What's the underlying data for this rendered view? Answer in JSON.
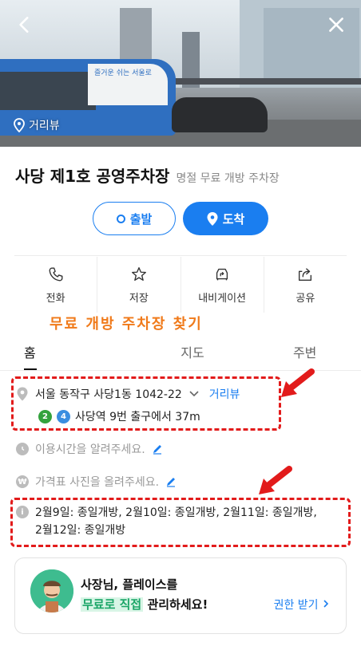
{
  "hero": {
    "street_view_label": "거리뷰",
    "bus_text": "즐거운 쉬는 서울로"
  },
  "place": {
    "name": "사당 제1호 공영주차장",
    "category": "명절 무료 개방 주차장"
  },
  "nav": {
    "start_label": "출발",
    "arrive_label": "도착"
  },
  "actions": [
    {
      "label": "전화",
      "icon": "phone-icon"
    },
    {
      "label": "저장",
      "icon": "star-icon"
    },
    {
      "label": "내비게이션",
      "icon": "car-icon"
    },
    {
      "label": "공유",
      "icon": "share-icon"
    }
  ],
  "banner": "무료 개방 주차장 찾기",
  "tabs": [
    {
      "label": "홈",
      "active": true
    },
    {
      "label": "지도",
      "active": false
    },
    {
      "label": "주변",
      "active": false
    }
  ],
  "address": {
    "text": "서울 동작구 사당1동 1042-22",
    "street_view_link": "거리뷰",
    "line1": "2",
    "line2": "4",
    "line1_color": "#33a23d",
    "line2_color": "#3a8ee0",
    "subway": "사당역 9번 출구에서 37m"
  },
  "hours_prompt": "이용시간을 알려주세요.",
  "price_prompt": "가격표 사진을 올려주세요.",
  "notice": {
    "line1": "2월9일: 종일개방, 2월10일: 종일개방, 2월11일: 종일개방,",
    "line2": "2월12일: 종일개방"
  },
  "owner_card": {
    "line1": "사장님, 플레이스를",
    "highlight": "무료로 직접",
    "line2_rest": " 관리하세요!",
    "cta": "권한 받기"
  },
  "colors": {
    "accent": "#1a7ef0",
    "annotation_red": "#e21b1b",
    "banner_orange": "#f07a1a"
  }
}
